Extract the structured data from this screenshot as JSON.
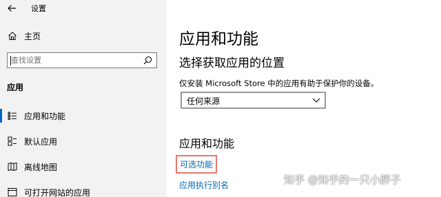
{
  "window": {
    "title": "设置"
  },
  "sidebar": {
    "home_label": "主页",
    "search": {
      "placeholder": "查找设置",
      "value": ""
    },
    "section_label": "应用",
    "items": [
      {
        "label": "应用和功能",
        "icon": "apps-list-icon",
        "active": true
      },
      {
        "label": "默认应用",
        "icon": "default-apps-icon",
        "active": false
      },
      {
        "label": "离线地图",
        "icon": "offline-maps-icon",
        "active": false
      },
      {
        "label": "可打开网站的应用",
        "icon": "website-apps-icon",
        "active": false
      }
    ]
  },
  "main": {
    "title": "应用和功能",
    "choose_location": {
      "heading": "选择获取应用的位置",
      "description": "仅安装 Microsoft Store 中的应用有助于保护你的设备。",
      "dropdown_value": "任何来源"
    },
    "apps_features": {
      "heading": "应用和功能",
      "optional_features_link": "可选功能",
      "execution_alias_link": "应用执行别名"
    }
  },
  "watermark": "知乎 @知乎的一只小胖子",
  "colors": {
    "sidebar_bg": "#f2f2f2",
    "accent": "#0067c0",
    "link": "#0067b8",
    "highlight_box": "#e8766c"
  }
}
